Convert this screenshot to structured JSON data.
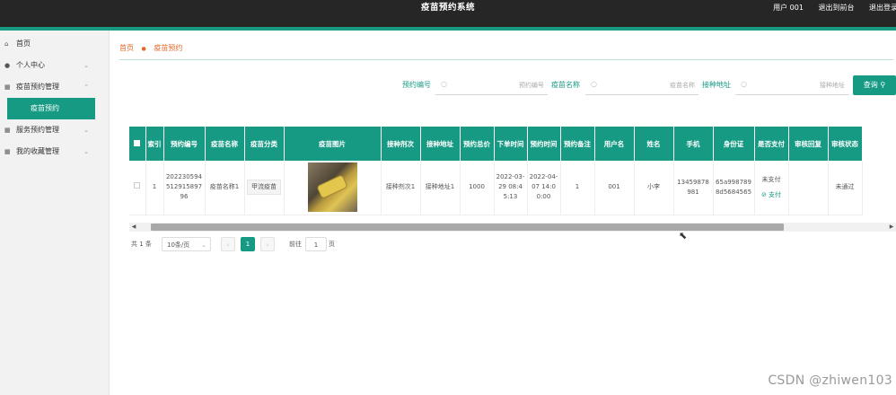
{
  "header": {
    "title": "疫苗预约系统",
    "user_label": "用户 001",
    "back_frontend": "退出到前台",
    "logout": "退出登录"
  },
  "sidebar": {
    "items": [
      {
        "label": "首页",
        "icon": "home-icon"
      },
      {
        "label": "个人中心",
        "icon": "user-icon"
      },
      {
        "label": "疫苗预约管理",
        "icon": "grid-icon"
      },
      {
        "label": "疫苗预约",
        "icon": ""
      },
      {
        "label": "服务预约管理",
        "icon": "grid-icon"
      },
      {
        "label": "我的收藏管理",
        "icon": "grid-icon"
      }
    ]
  },
  "breadcrumb": {
    "home": "首页",
    "current": "疫苗预约"
  },
  "search": {
    "fields": [
      {
        "label": "预约编号",
        "placeholder": "预约编号"
      },
      {
        "label": "疫苗名称",
        "placeholder": "疫苗名称"
      },
      {
        "label": "接种地址",
        "placeholder": "接种地址"
      }
    ],
    "query_button": "查询"
  },
  "table": {
    "columns": [
      "索引",
      "预约编号",
      "疫苗名称",
      "疫苗分类",
      "疫苗图片",
      "接种剂次",
      "接种地址",
      "预约总价",
      "下单时间",
      "预约时间",
      "预约备注",
      "用户名",
      "姓名",
      "手机",
      "身份证",
      "是否支付",
      "审核回复",
      "审核状态"
    ],
    "rows": [
      {
        "index": "1",
        "order_no": "20223059451291589796",
        "vaccine_name": "疫苗名称1",
        "category": "甲流疫苗",
        "dose": "接种剂次1",
        "address": "接种地址1",
        "total": "1000",
        "order_time": "2022-03-29 08:45:13",
        "appoint_time": "2022-04-07 14:00:00",
        "remark": "1",
        "username": "001",
        "name": "小李",
        "phone": "13459878981",
        "id_card": "65a9987898d5684565",
        "paid": "未支付",
        "pay_link": "支付",
        "reply": "",
        "status": "未通过"
      }
    ]
  },
  "pager": {
    "total": "共 1 条",
    "page_size": "10条/页",
    "current_page": "1",
    "goto_prefix": "前往",
    "goto_value": "1",
    "goto_suffix": "页"
  },
  "watermark": "CSDN @zhiwen103",
  "colors": {
    "accent": "#179a84",
    "topbar": "#262626",
    "breadcrumb": "#e06a2a"
  }
}
